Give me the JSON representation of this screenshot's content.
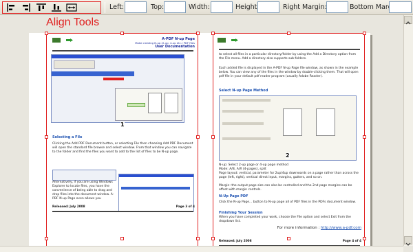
{
  "toolbar": {
    "tools": [
      {
        "icon": "align-left-icon"
      },
      {
        "icon": "align-right-icon"
      },
      {
        "icon": "align-top-icon"
      },
      {
        "icon": "align-bottom-icon"
      },
      {
        "icon": "fit-width-icon"
      }
    ],
    "left_label": "Left:",
    "top_label": "Top:",
    "width_label": "Width:",
    "height_label": "Height:",
    "right_margin_label": "Right Margin:",
    "bottom_margin_label": "Bottom Margin:",
    "left_value": "",
    "top_value": "",
    "width_value": "",
    "height_value": "",
    "right_margin_value": "",
    "bottom_margin_value": ""
  },
  "callout": "Align Tools",
  "accent_color": "#e02020",
  "pages": [
    {
      "number": "1",
      "title": "A-PDF N-up Page",
      "subtitle": "Make creating N-up (2-up, 4-up etc.) PDF files",
      "doc_title": "User Documentation",
      "section": "Selecting a File",
      "body1": "Clicking the Add PDF Document button, or selecting File then choosing Add PDF Document will open the standard file browse and select window. From that window you can navigate to the folder and find the files you want to add to the list of files to be N-up page.",
      "body2": "Alternatively, if you are using Windows Explorer to locate files, you have the convenience of being able to drag and drop files into the document window. A-PDF N-up Page even allows you",
      "footer_left": "Released: July 2008",
      "footer_right": "Page 3 of 4"
    },
    {
      "number": "2",
      "intro": "to select all files in a particular directory/folder by using the Add a Directory option from the File menu. Add a directory also supports sub-folders.",
      "para2": "Each added file is displayed in the A-PDF N-up Page file window, as shown in the example below. You can view any of the files in the window by double-clicking them. That will open pdf file in your default pdf reader program (usually Adobe Reader).",
      "section1": "Select N-up Page Method",
      "nup": "N-up: Select 2-up page or 4-up page method",
      "mode": "Mode: A/B, A/R (4-pages), split",
      "layout": "Page layout: vertical, parameter for 2up/4up downwards on a page rather than across the page (left, right), vertical direct input, margins, gutters, and so on.",
      "margin": "Margin: the output page size can also be controlled and the 2nd page margins can be offset with margin controls.",
      "section2": "N-Up Page PDF",
      "nup_text": "Click the N-up Page... button to N-up page all of PDF files in the PDFs document window.",
      "section3": "Finishing Your Session",
      "finish": "When you have completed your work, choose the File option and select Exit from the dropdown list.",
      "more_info": "For more information :",
      "url": "http://www.a-pdf.com",
      "footer_left": "Released: July 2008",
      "footer_right": "Page 4 of 4"
    }
  ]
}
